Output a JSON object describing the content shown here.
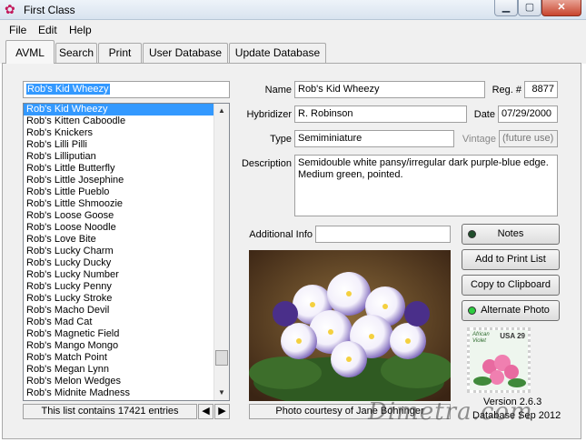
{
  "window": {
    "title": "First Class"
  },
  "menu": [
    "File",
    "Edit",
    "Help"
  ],
  "tabs": [
    "AVML",
    "Search",
    "Print",
    "User Database",
    "Update Database"
  ],
  "search_value": "Rob's Kid Wheezy",
  "list": {
    "items": [
      "Rob's Kid Wheezy",
      "Rob's Kitten Caboodle",
      "Rob's Knickers",
      "Rob's Lilli Pilli",
      "Rob's Lilliputian",
      "Rob's Little Butterfly",
      "Rob's Little Josephine",
      "Rob's Little Pueblo",
      "Rob's Little Shmoozie",
      "Rob's Loose Goose",
      "Rob's Loose Noodle",
      "Rob's Love Bite",
      "Rob's Lucky Charm",
      "Rob's Lucky Ducky",
      "Rob's Lucky Number",
      "Rob's Lucky Penny",
      "Rob's Lucky Stroke",
      "Rob's Macho Devil",
      "Rob's Mad Cat",
      "Rob's Magnetic Field",
      "Rob's Mango Mongo",
      "Rob's Match Point",
      "Rob's Megan Lynn",
      "Rob's Melon Wedges",
      "Rob's Midnite Madness"
    ],
    "selected_index": 0,
    "status": "This list contains 17421 entries",
    "scroll_position": 0.92
  },
  "labels": {
    "name": "Name",
    "reg": "Reg. #",
    "hybridizer": "Hybridizer",
    "date": "Date",
    "type": "Type",
    "vintage": "Vintage",
    "description": "Description",
    "additional": "Additional Info"
  },
  "record": {
    "name": "Rob's Kid Wheezy",
    "reg": "8877",
    "hybridizer": "R. Robinson",
    "date": "07/29/2000",
    "type": "Semiminiature",
    "vintage": "(future use)",
    "description": "Semidouble white pansy/irregular dark purple-blue edge. Medium green, pointed.",
    "additional_info": ""
  },
  "buttons": {
    "notes": "Notes",
    "print_list": "Add to Print List",
    "clipboard": "Copy to Clipboard",
    "alt_photo": "Alternate Photo"
  },
  "photo_caption": "Photo courtesy of Jane Bohringer",
  "stamp": {
    "text_line1": "African",
    "text_line2": "Violet",
    "denomination": "USA 29"
  },
  "version": "Version 2.6.3",
  "database_label": "Database Sep 2012",
  "watermark": "Dimetra.com",
  "colors": {
    "selection": "#3399ff",
    "notes_led": "#1f4d2b",
    "alt_photo_led": "#2ecc40"
  }
}
